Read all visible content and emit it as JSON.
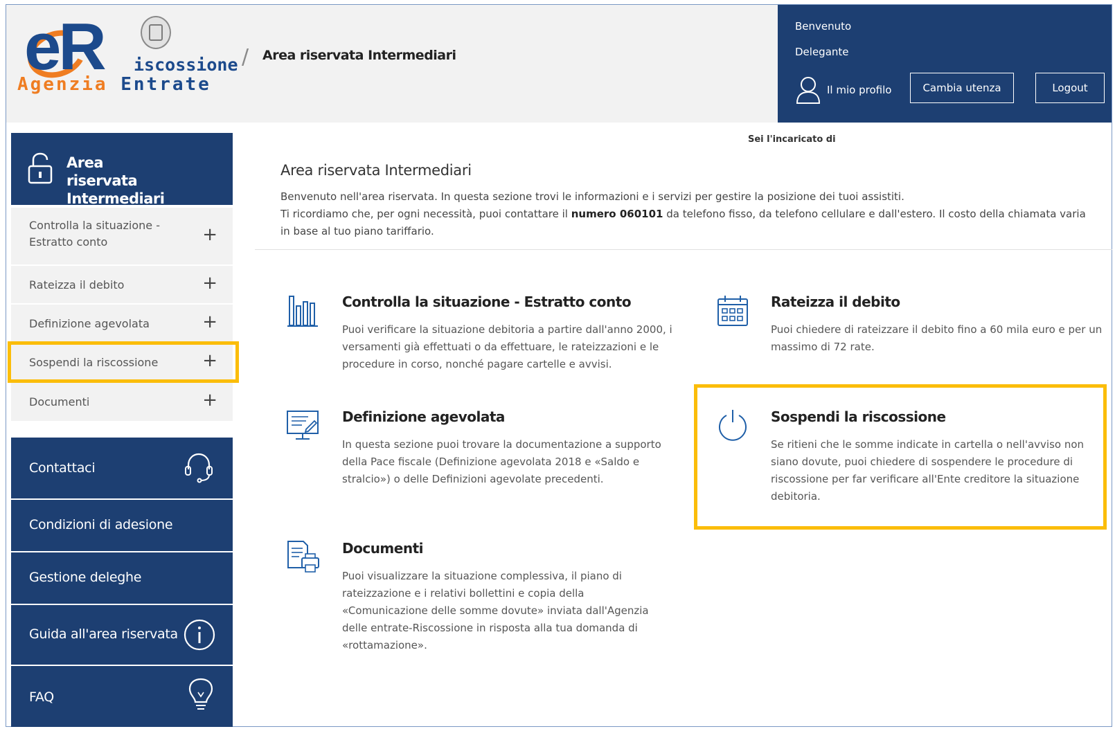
{
  "header": {
    "logo_text_line1": "iscossione",
    "logo_text_line2_a": "Agenzia",
    "logo_text_line2_b": "Entrate",
    "breadcrumb": "Area riservata Intermediari",
    "welcome": "Benvenuto",
    "role": "Delegante",
    "profile_label": "Il mio profilo",
    "change_user_label": "Cambia utenza",
    "logout_label": "Logout"
  },
  "sidebar": {
    "title": "Area riservata Intermediari",
    "items": [
      {
        "label": "Controlla la situazione - Estratto conto",
        "icon": "plus-icon"
      },
      {
        "label": "Rateizza il debito",
        "icon": "plus-icon"
      },
      {
        "label": "Definizione agevolata",
        "icon": "plus-icon"
      },
      {
        "label": "Sospendi la riscossione",
        "icon": "plus-icon"
      },
      {
        "label": "Documenti",
        "icon": "plus-icon"
      }
    ],
    "plus_glyph": "+",
    "links": [
      {
        "label": "Contattaci",
        "icon": "headset-icon"
      },
      {
        "label": "Condizioni di adesione"
      },
      {
        "label": "Gestione deleghe"
      },
      {
        "label": "Guida all'area riservata",
        "icon": "info-icon"
      },
      {
        "label": "FAQ",
        "icon": "lightbulb-icon"
      }
    ]
  },
  "main": {
    "incaricato": "Sei l'incaricato di",
    "title": "Area riservata Intermediari",
    "intro_line1": "Benvenuto nell'area riservata. In questa sezione trovi le informazioni e i servizi per gestire la posizione dei tuoi assistiti.",
    "intro_line2_pre": "Ti ricordiamo che, per ogni necessità, puoi contattare il ",
    "intro_line2_bold": "numero 060101",
    "intro_line2_post": " da telefono fisso, da telefono cellulare e dall'estero. Il costo della chiamata varia in base al tuo piano tariffario.",
    "cards": [
      {
        "title": "Controlla la situazione - Estratto conto",
        "text": "Puoi verificare la situazione debitoria a partire dall'anno 2000, i versamenti già effettuati o da effettuare, le rateizzazioni e le procedure in corso, nonché pagare cartelle e avvisi.",
        "icon": "bar-chart-icon"
      },
      {
        "title": "Rateizza il debito",
        "text": "Puoi chiedere di rateizzare il debito fino a 60 mila euro e per un massimo di 72 rate.",
        "icon": "calendar-icon"
      },
      {
        "title": "Definizione agevolata",
        "text": "In questa sezione puoi trovare la documentazione a supporto della Pace fiscale (Definizione agevolata 2018 e «Saldo e stralcio») o delle Definizioni agevolate precedenti.",
        "icon": "monitor-edit-icon"
      },
      {
        "title": "Sospendi la riscossione",
        "text": "Se ritieni che le somme indicate in cartella o nell'avviso non siano dovute, puoi chiedere di sospendere le procedure di riscossione per far verificare all'Ente creditore la situazione debitoria.",
        "icon": "power-icon"
      },
      {
        "title": "Documenti",
        "text": "Puoi visualizzare la situazione complessiva, il piano di rateizzazione e i relativi bollettini e copia della «Comunicazione delle somme dovute» inviata dall'Agenzia delle entrate-Riscossione in risposta alla tua domanda di «rottamazione».",
        "icon": "document-print-icon"
      }
    ]
  },
  "colors": {
    "navy": "#1d3f72",
    "highlight": "#fbbd0a",
    "logo_orange": "#ef7d22"
  }
}
